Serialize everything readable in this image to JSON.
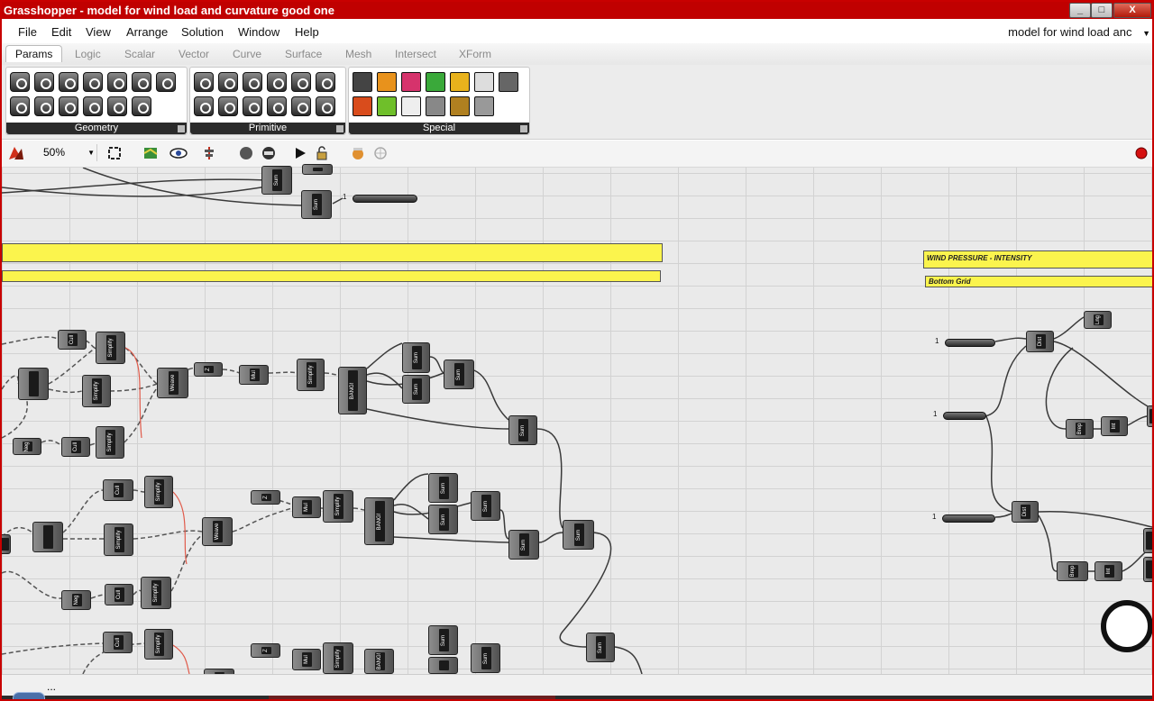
{
  "window": {
    "title": "Grasshopper - model for wind load and curvature good one",
    "buttons": {
      "minimize": "_",
      "maximize": "□",
      "close": "X"
    }
  },
  "menu": {
    "items": [
      "File",
      "Edit",
      "View",
      "Arrange",
      "Solution",
      "Window",
      "Help"
    ],
    "document": "model for wind load anc"
  },
  "tabs": [
    "Params",
    "Logic",
    "Scalar",
    "Vector",
    "Curve",
    "Surface",
    "Mesh",
    "Intersect",
    "XForm"
  ],
  "ribbon": {
    "panels": [
      "Geometry",
      "Primitive",
      "Special"
    ]
  },
  "toolbar": {
    "zoom": "50%"
  },
  "canvas": {
    "groups": [
      "WIND PRESSURE - INTENSITY",
      "Bottom Grid"
    ],
    "node_labels": {
      "sum": "Sum",
      "cull": "Cull",
      "simplify": "Simplify",
      "weave": "Weave",
      "z": "Z",
      "mul": "Mul",
      "bang": "BANG!",
      "neg": "Neg",
      "dist": "Dist",
      "lng": "Lng",
      "brep": "Brep",
      "int": "Int"
    },
    "param_count": "1"
  },
  "statusbar": {
    "text": "..."
  }
}
